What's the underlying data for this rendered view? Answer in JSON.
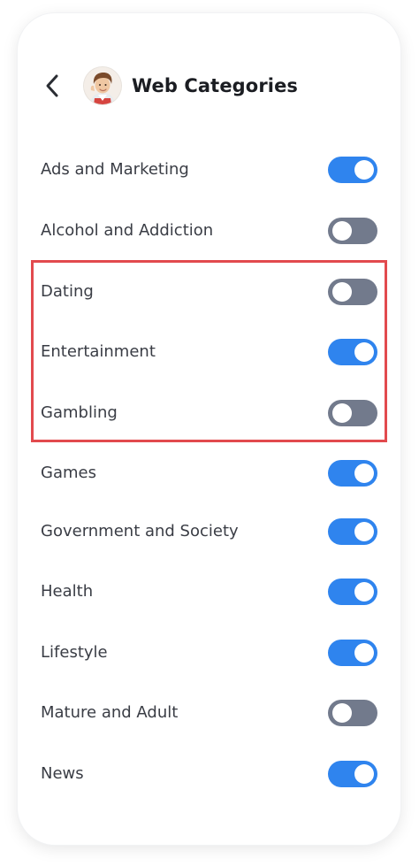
{
  "header": {
    "title": "Web Categories"
  },
  "colors": {
    "toggle_on": "#2f84ee",
    "toggle_off": "#727a8c",
    "highlight": "#e24a4e"
  },
  "categories": [
    {
      "label": "Ads and Marketing",
      "enabled": true
    },
    {
      "label": "Alcohol and Addiction",
      "enabled": false
    },
    {
      "label": "Dating",
      "enabled": false
    },
    {
      "label": "Entertainment",
      "enabled": true
    },
    {
      "label": "Gambling",
      "enabled": false
    },
    {
      "label": "Games",
      "enabled": true
    },
    {
      "label": "Government and Society",
      "enabled": true
    },
    {
      "label": "Health",
      "enabled": true
    },
    {
      "label": "Lifestyle",
      "enabled": true
    },
    {
      "label": "Mature and Adult",
      "enabled": false
    },
    {
      "label": "News",
      "enabled": true
    }
  ]
}
